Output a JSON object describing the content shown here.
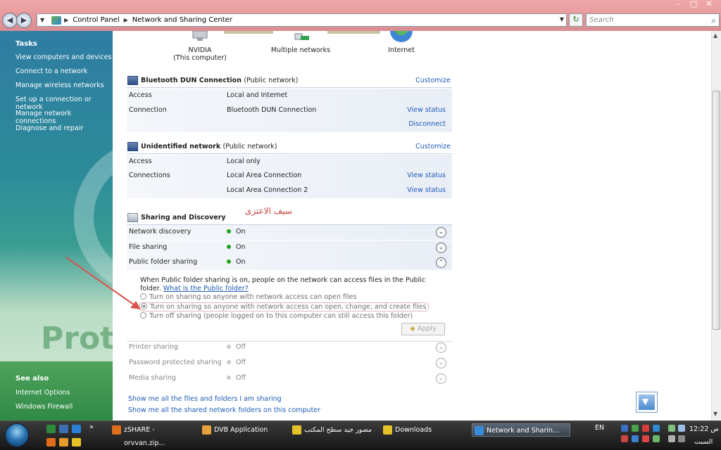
{
  "addressbar": {
    "crumbs": [
      "Control Panel",
      "Network and Sharing Center"
    ],
    "search_placeholder": "Search"
  },
  "sidebar": {
    "title": "Tasks",
    "links": [
      "View computers and devices",
      "Connect to a network",
      "Manage wireless networks",
      "Set up a connection or network",
      "Manage network connections",
      "Diagnose and repair"
    ],
    "see_also_title": "See also",
    "see_also": [
      "Internet Options",
      "Windows Firewall"
    ],
    "watermark": "Prote"
  },
  "map": {
    "computer_name": "NVIDIA",
    "computer_sub": "(This computer)",
    "middle": "Multiple networks",
    "internet": "Internet"
  },
  "bluetooth": {
    "name": "Bluetooth DUN Connection",
    "type": "(Public network)",
    "customize": "Customize",
    "rows": [
      {
        "key": "Access",
        "value": "Local and Internet",
        "link": ""
      },
      {
        "key": "Connection",
        "value": "Bluetooth DUN Connection",
        "link": "View status"
      },
      {
        "key": "",
        "value": "",
        "link": "Disconnect"
      }
    ]
  },
  "unidentified": {
    "name": "Unidentified network",
    "type": "(Public network)",
    "customize": "Customize",
    "rows": [
      {
        "key": "Access",
        "value": "Local only",
        "link": ""
      },
      {
        "key": "Connections",
        "value": "Local Area Connection",
        "link": "View status"
      },
      {
        "key": "",
        "value": "Local Area Connection 2",
        "link": "View status"
      }
    ]
  },
  "sharing": {
    "title": "Sharing and Discovery",
    "annotation": "سيف الاعتزى",
    "rows": [
      {
        "key": "Network discovery",
        "state": "On"
      },
      {
        "key": "File sharing",
        "state": "On"
      },
      {
        "key": "Public folder sharing",
        "state": "On"
      }
    ],
    "expander": {
      "text": "When Public folder sharing is on, people on the network can access files in the Public folder.",
      "link": "What is the Public folder?",
      "options": [
        "Turn on sharing so anyone with network access can open files",
        "Turn on sharing so anyone with network access can open, change, and create files",
        "Turn off sharing (people logged on to this computer can still access this folder)"
      ],
      "apply": "Apply"
    },
    "rows_after": [
      {
        "key": "Printer sharing",
        "state": "Off"
      },
      {
        "key": "Password protected sharing",
        "state": "Off"
      },
      {
        "key": "Media sharing",
        "state": "Off"
      }
    ]
  },
  "bottom_links": [
    "Show me all the files and folders I am sharing",
    "Show me all the shared network folders on this computer"
  ],
  "taskbar": {
    "quicklaunch_more": "»",
    "items": [
      "zSHARE - orvvan.zip...",
      "DVB Application",
      "مصور جيد سطح المكتب",
      "Downloads",
      "Network and Sharin..."
    ],
    "lang": "EN",
    "time": "12:22 ص",
    "day": "السبت"
  }
}
